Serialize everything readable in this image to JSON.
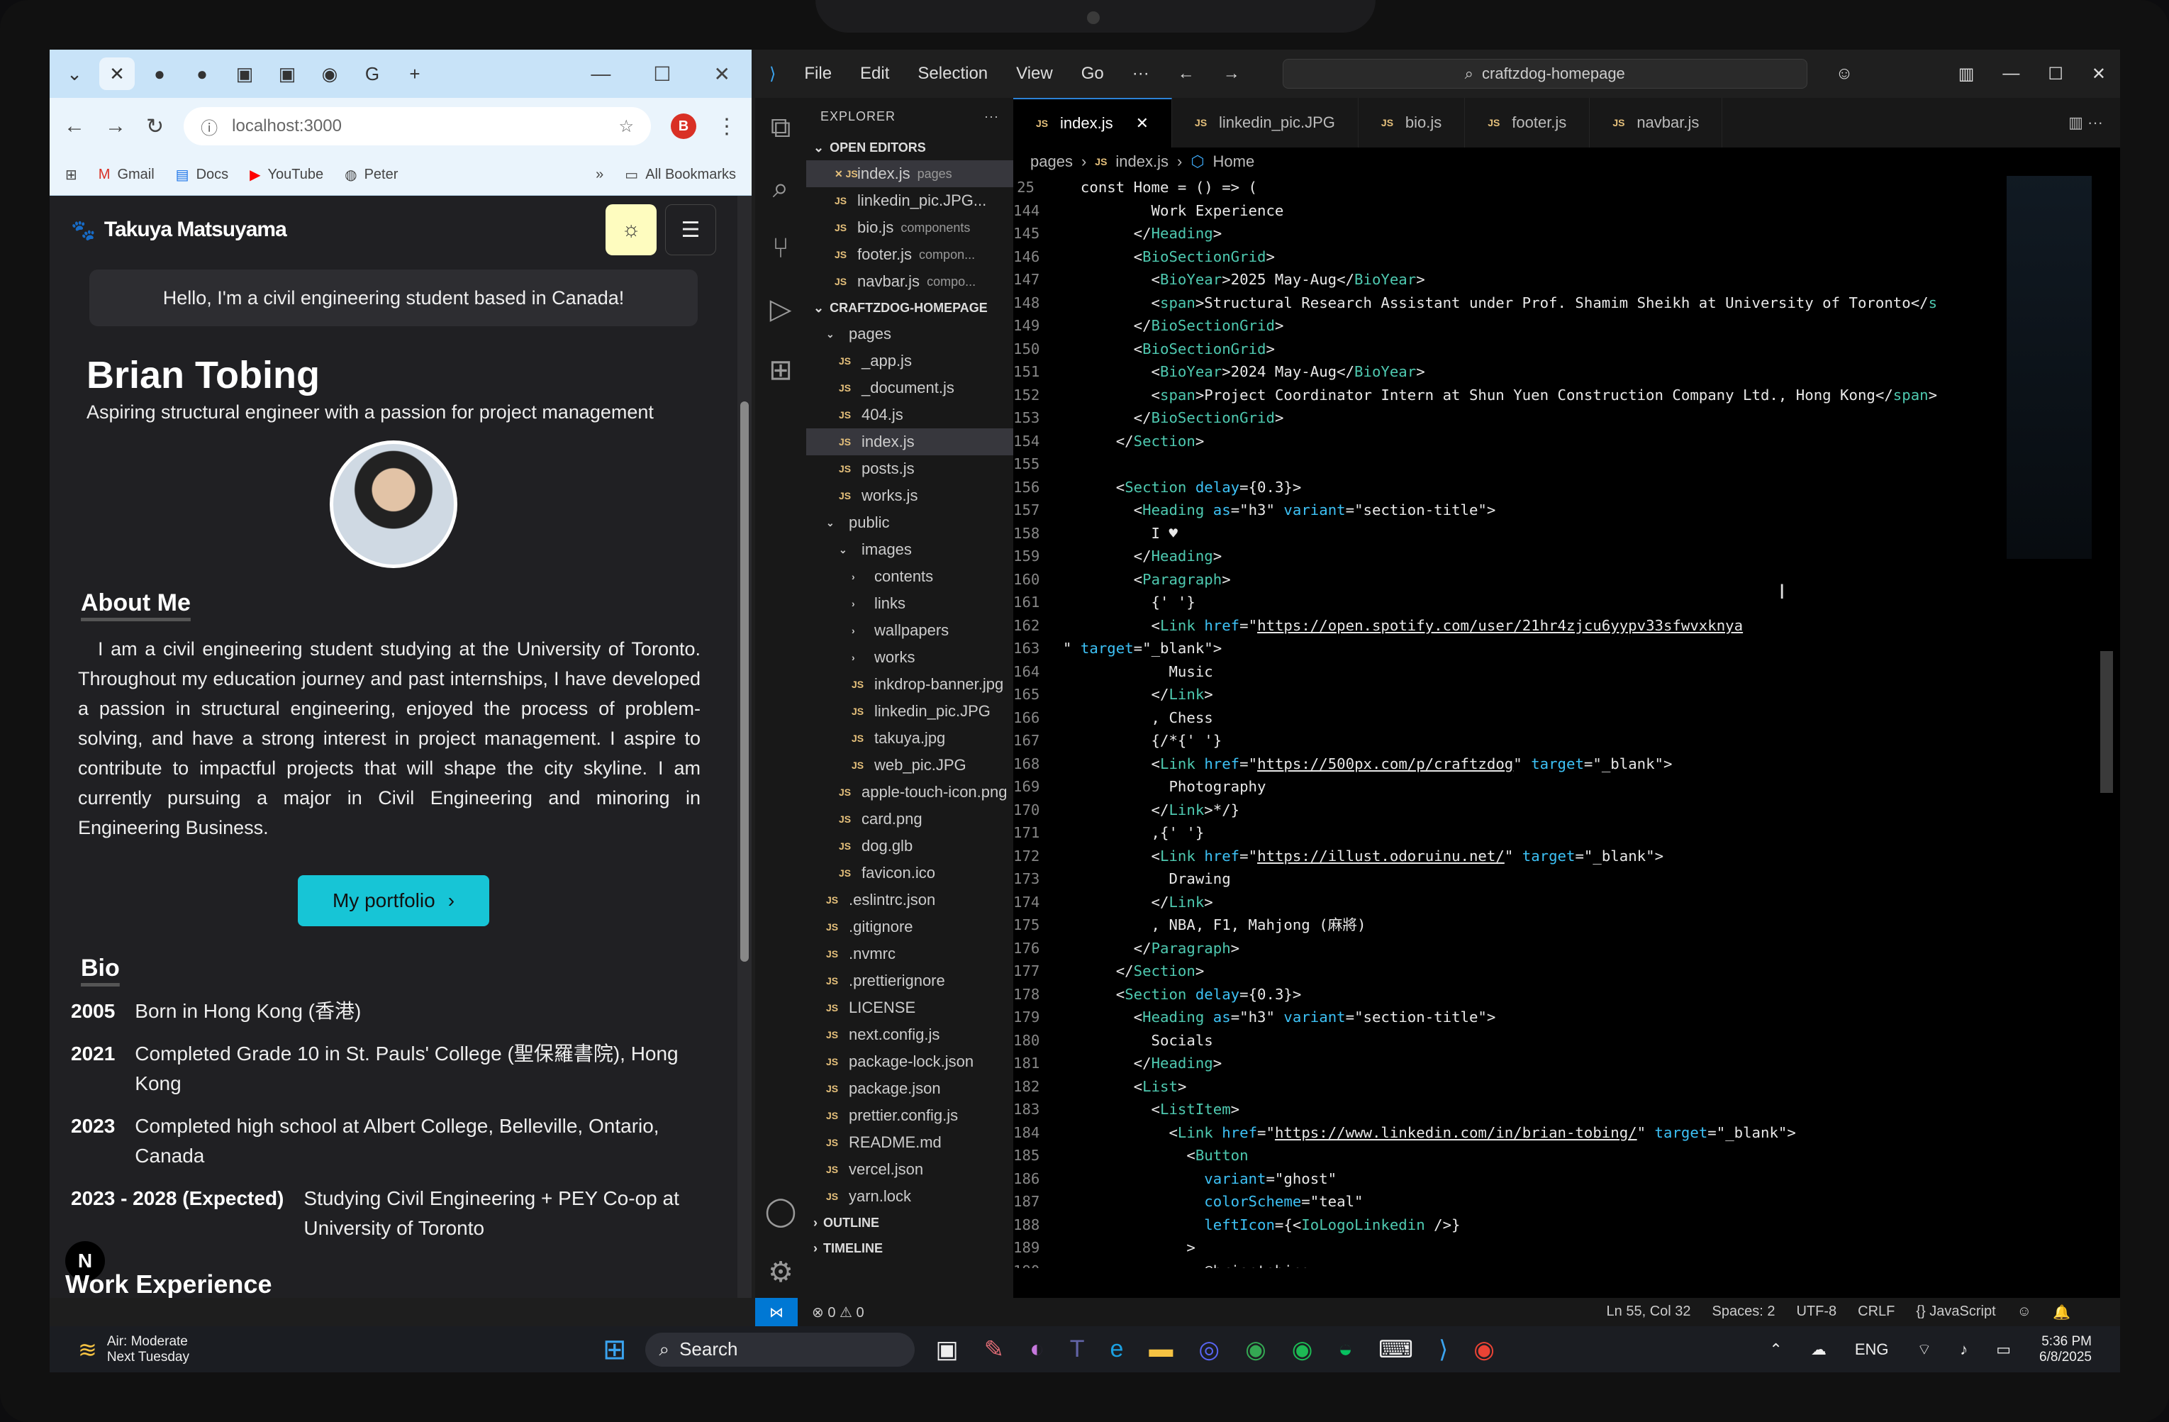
{
  "browser": {
    "tab_plus": "+",
    "address": "localhost:3000",
    "profile_letter": "B",
    "bookmarks": [
      {
        "label": "Gmail",
        "icon": "gmail-icon"
      },
      {
        "label": "Docs",
        "icon": "docs-icon"
      },
      {
        "label": "YouTube",
        "icon": "youtube-icon"
      },
      {
        "label": "Peter",
        "icon": "globe-icon"
      }
    ],
    "all_bookmarks": "All Bookmarks"
  },
  "site": {
    "logo": "Takuya Matsuyama",
    "hello": "Hello, I'm a civil engineering student based in Canada!",
    "name": "Brian Tobing",
    "tagline": "Aspiring structural engineer with a passion for project management",
    "about_heading": "About Me",
    "about_text": "I am a civil engineering student studying at the University of Toronto. Throughout my education journey and past internships, I have developed a passion in structural engineering, enjoyed the process of problem-solving, and have a strong interest in project management. I aspire to contribute to impactful projects that will shape the city skyline. I am currently pursuing a major in Civil Engineering and minoring in Engineering Business.",
    "portfolio_button": "My portfolio",
    "bio_heading": "Bio",
    "bio": [
      {
        "year": "2005",
        "text": "Born in Hong Kong (香港)"
      },
      {
        "year": "2021",
        "text": "Completed Grade 10 in St. Pauls' College (聖保羅書院), Hong Kong"
      },
      {
        "year": "2023",
        "text": "Completed high school at Albert College, Belleville, Ontario, Canada"
      },
      {
        "year": "2023 - 2028 (Expected)",
        "text": "Studying Civil Engineering + PEY Co-op at University of Toronto"
      }
    ],
    "n_badge": "N",
    "work_heading": "Work Experience"
  },
  "vscode": {
    "menu": [
      "File",
      "Edit",
      "Selection",
      "View",
      "Go",
      "···"
    ],
    "search": "craftzdog-homepage",
    "tabs": [
      {
        "label": "index.js",
        "active": true
      },
      {
        "label": "linkedin_pic.JPG",
        "active": false
      },
      {
        "label": "bio.js",
        "active": false
      },
      {
        "label": "footer.js",
        "active": false
      },
      {
        "label": "navbar.js",
        "active": false
      }
    ],
    "breadcrumb": [
      "pages",
      "index.js",
      "Home"
    ],
    "explorer_title": "EXPLORER",
    "open_editors_title": "OPEN EDITORS",
    "open_editors": [
      {
        "name": "index.js",
        "hint": "pages"
      },
      {
        "name": "linkedin_pic.JPG...",
        "hint": ""
      },
      {
        "name": "bio.js",
        "hint": "components"
      },
      {
        "name": "footer.js",
        "hint": "compon..."
      },
      {
        "name": "navbar.js",
        "hint": "compo..."
      }
    ],
    "project_title": "CRAFTZDOG-HOMEPAGE",
    "tree": [
      {
        "name": "pages",
        "folder": true,
        "indent": 1
      },
      {
        "name": "_app.js",
        "indent": 2
      },
      {
        "name": "_document.js",
        "indent": 2
      },
      {
        "name": "404.js",
        "indent": 2
      },
      {
        "name": "index.js",
        "indent": 2,
        "selected": true
      },
      {
        "name": "posts.js",
        "indent": 2
      },
      {
        "name": "works.js",
        "indent": 2
      },
      {
        "name": "public",
        "folder": true,
        "indent": 1
      },
      {
        "name": "images",
        "folder": true,
        "indent": 2
      },
      {
        "name": "contents",
        "folder": true,
        "closed": true,
        "indent": 3
      },
      {
        "name": "links",
        "folder": true,
        "closed": true,
        "indent": 3
      },
      {
        "name": "wallpapers",
        "folder": true,
        "closed": true,
        "indent": 3
      },
      {
        "name": "works",
        "folder": true,
        "closed": true,
        "indent": 3
      },
      {
        "name": "inkdrop-banner.jpg",
        "indent": 3
      },
      {
        "name": "linkedin_pic.JPG",
        "indent": 3
      },
      {
        "name": "takuya.jpg",
        "indent": 3
      },
      {
        "name": "web_pic.JPG",
        "indent": 3
      },
      {
        "name": "apple-touch-icon.png",
        "indent": 2
      },
      {
        "name": "card.png",
        "indent": 2
      },
      {
        "name": "dog.glb",
        "indent": 2
      },
      {
        "name": "favicon.ico",
        "indent": 2
      },
      {
        "name": ".eslintrc.json",
        "indent": 1
      },
      {
        "name": ".gitignore",
        "indent": 1
      },
      {
        "name": ".nvmrc",
        "indent": 1
      },
      {
        "name": ".prettierignore",
        "indent": 1
      },
      {
        "name": "LICENSE",
        "indent": 1
      },
      {
        "name": "next.config.js",
        "indent": 1
      },
      {
        "name": "package-lock.json",
        "indent": 1
      },
      {
        "name": "package.json",
        "indent": 1
      },
      {
        "name": "prettier.config.js",
        "indent": 1
      },
      {
        "name": "README.md",
        "indent": 1
      },
      {
        "name": "vercel.json",
        "indent": 1
      },
      {
        "name": "yarn.lock",
        "indent": 1
      }
    ],
    "outline": "OUTLINE",
    "timeline": "TIMELINE",
    "code_lines": [
      {
        "n": "25",
        "t": "  const Home = () => ("
      },
      {
        "n": "144",
        "t": "          Work Experience"
      },
      {
        "n": "145",
        "t": "        </Heading>"
      },
      {
        "n": "146",
        "t": "        <BioSectionGrid>"
      },
      {
        "n": "147",
        "t": "          <BioYear>2025 May-Aug</BioYear>"
      },
      {
        "n": "148",
        "t": "          <span>Structural Research Assistant under Prof. Shamim Sheikh at University of Toronto</s"
      },
      {
        "n": "149",
        "t": "        </BioSectionGrid>"
      },
      {
        "n": "150",
        "t": "        <BioSectionGrid>"
      },
      {
        "n": "151",
        "t": "          <BioYear>2024 May-Aug</BioYear>"
      },
      {
        "n": "152",
        "t": "          <span>Project Coordinator Intern at Shun Yuen Construction Company Ltd., Hong Kong</span>"
      },
      {
        "n": "153",
        "t": "        </BioSectionGrid>"
      },
      {
        "n": "154",
        "t": "      </Section>"
      },
      {
        "n": "155",
        "t": ""
      },
      {
        "n": "156",
        "t": "      <Section delay={0.3}>"
      },
      {
        "n": "157",
        "t": "        <Heading as=\"h3\" variant=\"section-title\">"
      },
      {
        "n": "158",
        "t": "          I ♥"
      },
      {
        "n": "159",
        "t": "        </Heading>"
      },
      {
        "n": "160",
        "t": "        <Paragraph>"
      },
      {
        "n": "161",
        "t": "          {' '}"
      },
      {
        "n": "162",
        "t": "          <Link href=\"https://open.spotify.com/user/21hr4zjcu6yypv33sfwvxknya"
      },
      {
        "n": "163",
        "t": "\" target=\"_blank\">"
      },
      {
        "n": "164",
        "t": "            Music"
      },
      {
        "n": "165",
        "t": "          </Link>"
      },
      {
        "n": "166",
        "t": "          , Chess"
      },
      {
        "n": "167",
        "t": "          {/*{' '}"
      },
      {
        "n": "168",
        "t": "          <Link href=\"https://500px.com/p/craftzdog\" target=\"_blank\">"
      },
      {
        "n": "169",
        "t": "            Photography"
      },
      {
        "n": "170",
        "t": "          </Link>*/}"
      },
      {
        "n": "171",
        "t": "          ,{' '}"
      },
      {
        "n": "172",
        "t": "          <Link href=\"https://illust.odoruinu.net/\" target=\"_blank\">"
      },
      {
        "n": "173",
        "t": "            Drawing"
      },
      {
        "n": "174",
        "t": "          </Link>"
      },
      {
        "n": "175",
        "t": "          , NBA, F1, Mahjong (麻將)"
      },
      {
        "n": "176",
        "t": "        </Paragraph>"
      },
      {
        "n": "177",
        "t": "      </Section>"
      },
      {
        "n": "178",
        "t": "      <Section delay={0.3}>"
      },
      {
        "n": "179",
        "t": "        <Heading as=\"h3\" variant=\"section-title\">"
      },
      {
        "n": "180",
        "t": "          Socials"
      },
      {
        "n": "181",
        "t": "        </Heading>"
      },
      {
        "n": "182",
        "t": "        <List>"
      },
      {
        "n": "183",
        "t": "          <ListItem>"
      },
      {
        "n": "184",
        "t": "            <Link href=\"https://www.linkedin.com/in/brian-tobing/\" target=\"_blank\">"
      },
      {
        "n": "185",
        "t": "              <Button"
      },
      {
        "n": "186",
        "t": "                variant=\"ghost\""
      },
      {
        "n": "187",
        "t": "                colorScheme=\"teal\""
      },
      {
        "n": "188",
        "t": "                leftIcon={<IoLogoLinkedin />}"
      },
      {
        "n": "189",
        "t": "              >"
      },
      {
        "n": "190",
        "t": "                @briantobing"
      }
    ],
    "status": {
      "errors": "⊗ 0 ⚠ 0",
      "position": "Ln 55, Col 32",
      "spaces": "Spaces: 2",
      "encoding": "UTF-8",
      "eol": "CRLF",
      "language": "{} JavaScript"
    }
  },
  "taskbar": {
    "weather_title": "Air: Moderate",
    "weather_sub": "Next Tuesday",
    "search": "Search",
    "lang": "ENG",
    "time": "5:36 PM",
    "date": "6/8/2025"
  }
}
